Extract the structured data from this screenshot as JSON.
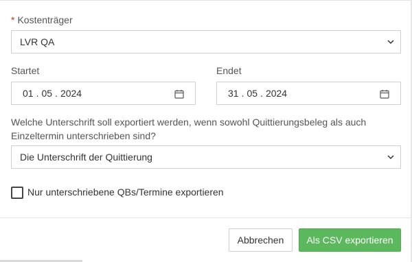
{
  "form": {
    "payer": {
      "required_mark": "*",
      "label": "Kostenträger",
      "value": "LVR QA"
    },
    "start": {
      "label": "Startet",
      "day": "01",
      "month": "05",
      "year": "2024"
    },
    "end": {
      "label": "Endet",
      "day": "31",
      "month": "05",
      "year": "2024"
    },
    "date_separator": ".",
    "signature": {
      "question": "Welche Unterschrift soll exportiert werden, wenn sowohl Quittierungsbeleg als auch Einzeltermin unterschrieben sind?",
      "value": "Die Unterschrift der Quittierung"
    },
    "only_signed": {
      "label": "Nur unterschriebene QBs/Termine exportieren",
      "checked": false
    }
  },
  "footer": {
    "cancel_label": "Abbrechen",
    "export_label": "Als CSV exportieren"
  },
  "icons": {
    "select": "chevron-down-icon",
    "date": "calendar-icon"
  },
  "colors": {
    "primary": "#5cb85c",
    "required": "#c0392b",
    "border": "#cfcfcf"
  }
}
